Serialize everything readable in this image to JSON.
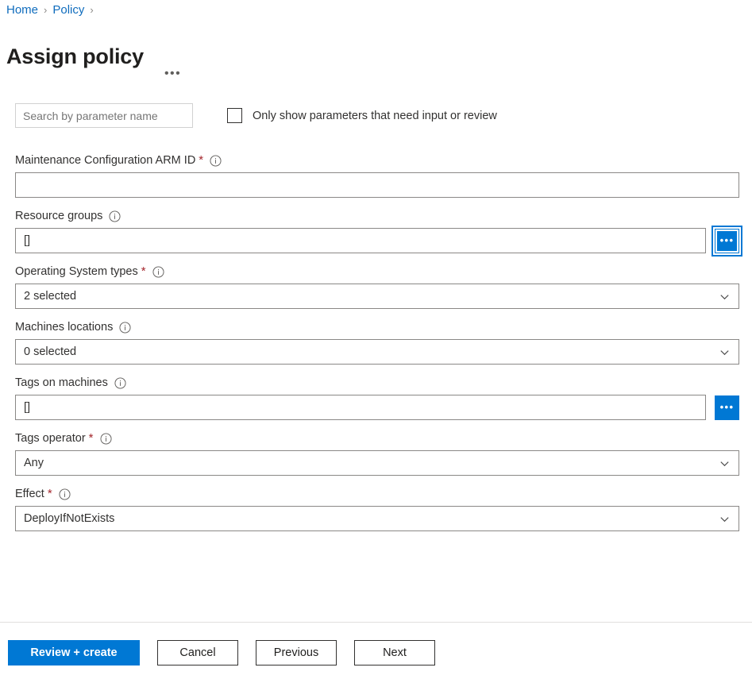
{
  "breadcrumb": {
    "items": [
      {
        "label": "Home"
      },
      {
        "label": "Policy"
      }
    ],
    "separator": "›"
  },
  "header": {
    "title": "Assign policy",
    "more_label": "•••"
  },
  "filters": {
    "search_placeholder": "Search by parameter name",
    "search_value": "",
    "checkbox_label": "Only show parameters that need input or review",
    "checkbox_checked": false
  },
  "fields": [
    {
      "label": "Maintenance Configuration ARM ID",
      "required": true,
      "info": true,
      "type": "text",
      "value": "",
      "picker": false
    },
    {
      "label": "Resource groups",
      "required": false,
      "info": true,
      "type": "text",
      "value": "[]",
      "picker": true,
      "picker_label": "•••",
      "picker_focused": true
    },
    {
      "label": "Operating System types",
      "required": true,
      "info": true,
      "type": "select",
      "value": "2 selected",
      "picker": false
    },
    {
      "label": "Machines locations",
      "required": false,
      "info": true,
      "type": "select",
      "value": "0 selected",
      "picker": false
    },
    {
      "label": "Tags on machines",
      "required": false,
      "info": true,
      "type": "text",
      "value": "[]",
      "picker": true,
      "picker_label": "•••",
      "picker_focused": false
    },
    {
      "label": "Tags operator",
      "required": true,
      "info": true,
      "type": "select",
      "value": "Any",
      "picker": false
    },
    {
      "label": "Effect",
      "required": true,
      "info": true,
      "type": "select",
      "value": "DeployIfNotExists",
      "picker": false
    }
  ],
  "footer": {
    "buttons": [
      {
        "label": "Review + create",
        "primary": true
      },
      {
        "label": "Cancel",
        "primary": false
      },
      {
        "label": "Previous",
        "primary": false
      },
      {
        "label": "Next",
        "primary": false
      }
    ]
  },
  "colors": {
    "accent": "#0078d4",
    "link": "#0f6cbd",
    "required": "#a4262c",
    "text": "#323130",
    "border": "#8a8886"
  }
}
